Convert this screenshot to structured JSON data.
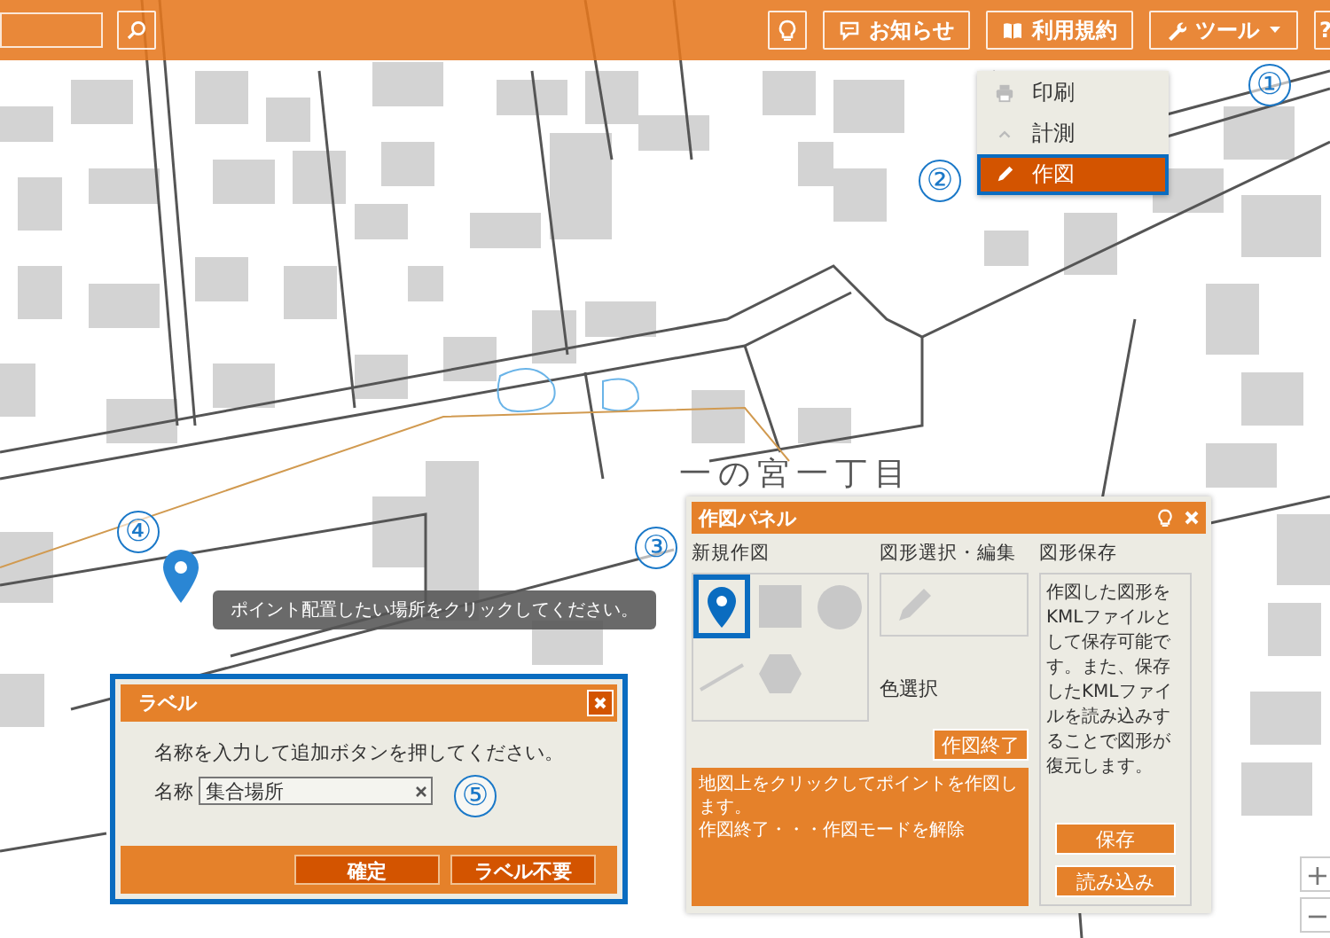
{
  "map": {
    "labels": [
      {
        "text": "一の宮一丁目"
      }
    ]
  },
  "toolbar": {
    "buttons": [
      {
        "kind": "hint"
      },
      {
        "kind": "news",
        "label": "お知らせ"
      },
      {
        "kind": "terms",
        "label": "利用規約"
      },
      {
        "kind": "tools",
        "label": "ツール"
      },
      {
        "kind": "help",
        "label": "?"
      }
    ]
  },
  "tools_menu": {
    "items": [
      {
        "kind": "print",
        "label": "印刷",
        "selected": false
      },
      {
        "kind": "measure",
        "label": "計測",
        "selected": false
      },
      {
        "kind": "draw",
        "label": "作図",
        "selected": true
      }
    ]
  },
  "callouts": [
    "①",
    "②",
    "③",
    "④",
    "⑤"
  ],
  "tooltip": {
    "text": "ポイント配置したい場所をクリックしてください。"
  },
  "drawing_panel": {
    "title": "作図パネル",
    "new_heading": "新規作図",
    "tools": [
      {
        "kind": "point",
        "selected": true
      },
      {
        "kind": "rectangle",
        "selected": false
      },
      {
        "kind": "circle",
        "selected": false
      },
      {
        "kind": "line",
        "selected": false
      },
      {
        "kind": "polygon",
        "selected": false
      }
    ],
    "edit_heading": "図形選択・編集",
    "color_label": "色選択",
    "save_heading": "図形保存",
    "save_description": "作図した図形をKMLファイルとして保存可能です。また、保存したKMLファイルを読み込みすることで図形が復元します。",
    "end_button": "作図終了",
    "info_lines": [
      "地図上をクリックしてポイントを作図します。",
      "作図終了・・・作図モードを解除"
    ],
    "save_buttons": [
      "保存",
      "読み込み"
    ]
  },
  "label_dialog": {
    "title": "ラベル",
    "message": "名称を入力して追加ボタンを押してください。",
    "name_label": "名称",
    "name_value": "集合場所",
    "buttons": [
      "確定",
      "ラベル不要"
    ]
  },
  "zoom_controls": [
    "+",
    "−"
  ]
}
